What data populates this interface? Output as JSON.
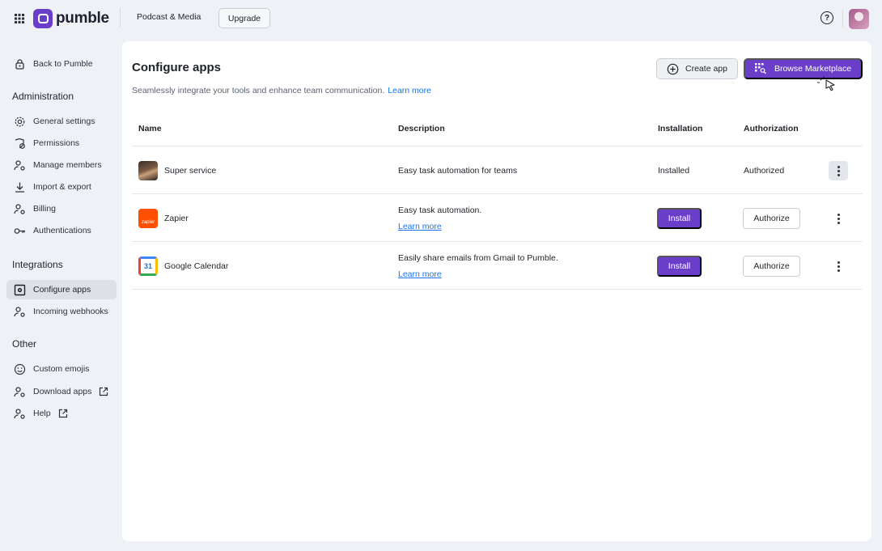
{
  "topbar": {
    "logo_text": "pumble",
    "workspace_name": "Podcast & Media",
    "upgrade_label": "Upgrade",
    "help_glyph": "?",
    "brand_color": "#6b3ec9"
  },
  "sidebar": {
    "back_label": "Back to Pumble",
    "sections": {
      "administration": "Administration",
      "integrations": "Integrations",
      "other": "Other"
    },
    "admin_items": [
      {
        "label": "General settings",
        "icon": "gear-icon"
      },
      {
        "label": "Permissions",
        "icon": "permissions-icon"
      },
      {
        "label": "Manage members",
        "icon": "members-icon"
      },
      {
        "label": "Import & export",
        "icon": "download-icon"
      },
      {
        "label": "Billing",
        "icon": "billing-icon"
      },
      {
        "label": "Authentications",
        "icon": "key-icon"
      }
    ],
    "integration_items": [
      {
        "label": "Configure apps",
        "icon": "apps-icon",
        "active": true
      },
      {
        "label": "Incoming webhooks",
        "icon": "webhook-icon"
      }
    ],
    "other_items": [
      {
        "label": "Custom emojis",
        "icon": "smile-icon"
      },
      {
        "label": "Download apps",
        "icon": "download-apps-icon",
        "external": true
      },
      {
        "label": "Help",
        "icon": "help-person-icon",
        "external": true
      }
    ]
  },
  "main": {
    "title": "Configure apps",
    "subtitle": "Seamlessly integrate your tools and enhance team communication.",
    "subtitle_link": "Learn more",
    "create_app_label": "Create app",
    "browse_marketplace_label": "Browse Marketplace",
    "columns": [
      "Name",
      "Description",
      "Installation",
      "Authorization"
    ],
    "apps": [
      {
        "name": "Super service",
        "description": "Easy task automation for teams",
        "learn_more": "",
        "installation": "Installed",
        "authorization": "Authorized",
        "icon": "super-service-icon"
      },
      {
        "name": "Zapier",
        "description": "Easy task automation.",
        "learn_more": "Learn more",
        "install_button": "Install",
        "authorize_button": "Authorize",
        "icon": "zapier-icon",
        "icon_text": "zapier"
      },
      {
        "name": "Google Calendar",
        "description": "Easily share emails from Gmail to Pumble.",
        "learn_more": "Learn more",
        "install_button": "Install",
        "authorize_button": "Authorize",
        "icon": "google-calendar-icon",
        "icon_text": "31"
      }
    ]
  }
}
